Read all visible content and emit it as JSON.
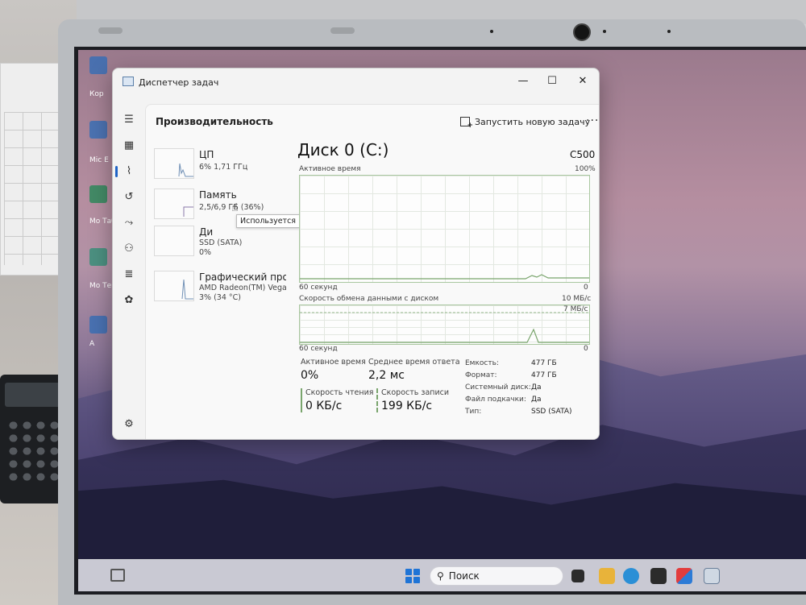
{
  "window": {
    "title": "Диспетчер задач",
    "controls": {
      "minimize": "—",
      "maximize": "☐",
      "close": "✕"
    }
  },
  "header": {
    "title": "Производительность",
    "run_task": "Запустить новую задачу",
    "more": "···"
  },
  "rail_icons": [
    "hamburger-icon",
    "processes-icon",
    "performance-icon",
    "app-history-icon",
    "startup-icon",
    "users-icon",
    "details-icon",
    "services-icon",
    "settings-icon"
  ],
  "resources": [
    {
      "name": "ЦП",
      "sub1": "6% 1,71 ГГц",
      "sub2": ""
    },
    {
      "name": "Память",
      "sub1": "2,5/6,9 ГБ (36%)",
      "sub2": ""
    },
    {
      "name": "Ди",
      "sub1": "SSD (SATA)",
      "sub2": "0%"
    },
    {
      "name": "Графический проц",
      "sub1": "AMD Radeon(TM) Vega",
      "sub2": "3% (34 °C)"
    }
  ],
  "tooltip": "Используется",
  "detail": {
    "title": "Диск 0 (C:)",
    "model": "C500",
    "graph1": {
      "label": "Активное время",
      "max": "100%",
      "time": "60 секунд",
      "min": "0"
    },
    "graph2": {
      "label": "Скорость обмена данными с диском",
      "max": "10 МБ/с",
      "mid": "7 МБ/с",
      "time": "60 секунд",
      "min": "0"
    },
    "stats": {
      "active_label": "Активное время",
      "active_value": "0%",
      "response_label": "Среднее время ответа",
      "response_value": "2,2 мс",
      "read_label": "Скорость чтения",
      "read_value": "0 КБ/с",
      "write_label": "Скорость записи",
      "write_value": "199 КБ/с"
    },
    "properties": [
      {
        "label": "Емкость:",
        "value": "477 ГБ"
      },
      {
        "label": "Формат:",
        "value": "477 ГБ"
      },
      {
        "label": "Системный диск:",
        "value": "Да"
      },
      {
        "label": "Файл подкачки:",
        "value": "Да"
      },
      {
        "label": "Тип:",
        "value": "SSD (SATA)"
      }
    ]
  },
  "taskbar": {
    "search_label": "Поиск"
  },
  "desktop": {
    "labels": [
      "Кор",
      "Mic E",
      "Мо Таб",
      "Мо Тек",
      "A"
    ]
  },
  "colors": {
    "graph_line": "#7aa56d",
    "accent": "#1f63c6"
  }
}
